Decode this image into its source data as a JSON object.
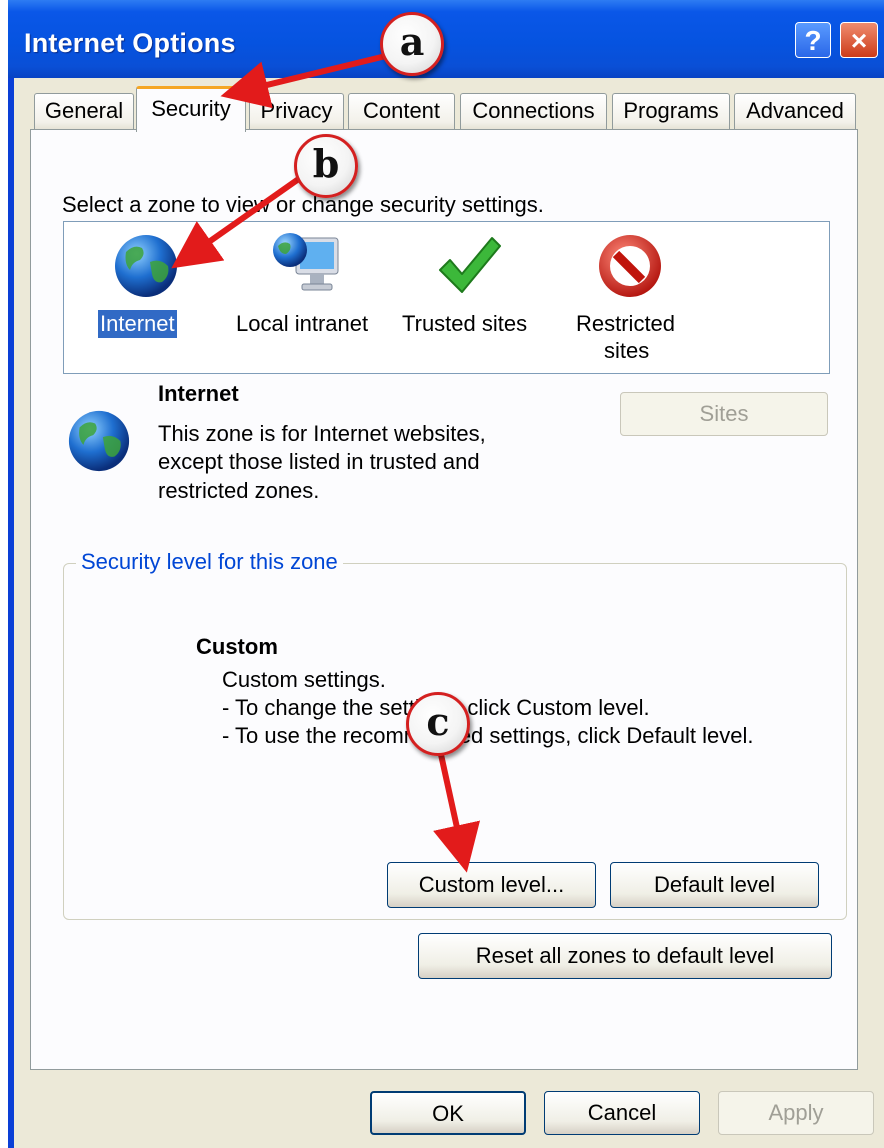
{
  "window": {
    "title": "Internet Options",
    "help_glyph": "?",
    "close_glyph": "×"
  },
  "tabs": [
    "General",
    "Security",
    "Privacy",
    "Content",
    "Connections",
    "Programs",
    "Advanced"
  ],
  "active_tab": "Security",
  "zone_prompt": "Select a zone to view or change security settings.",
  "zones": [
    {
      "label": "Internet",
      "icon": "globe-icon",
      "selected": true
    },
    {
      "label": "Local intranet",
      "icon": "intranet-monitor-icon"
    },
    {
      "label": "Trusted sites",
      "icon": "green-check-icon"
    },
    {
      "label_line1": "Restricted",
      "label_line2": "sites",
      "icon": "no-entry-icon"
    }
  ],
  "zone_info": {
    "title": "Internet",
    "lines": [
      "This zone is for Internet websites,",
      "except those listed in trusted and",
      "restricted zones."
    ]
  },
  "sites_button": "Sites",
  "security_level": {
    "legend": "Security level for this zone",
    "level_title": "Custom",
    "lines": [
      "Custom settings.",
      "- To change the settings, click Custom level.",
      "- To use the recommended settings, click Default level."
    ]
  },
  "buttons": {
    "custom_level": "Custom level...",
    "default_level": "Default level",
    "reset_all": "Reset all zones to default level",
    "ok": "OK",
    "cancel": "Cancel",
    "apply": "Apply"
  },
  "annotations": [
    "a",
    "b",
    "c"
  ],
  "colors": {
    "titlebar": "#0a57e8",
    "selection": "#316ac5",
    "legend_text": "#0046d5",
    "arrow": "#e21b1b"
  }
}
